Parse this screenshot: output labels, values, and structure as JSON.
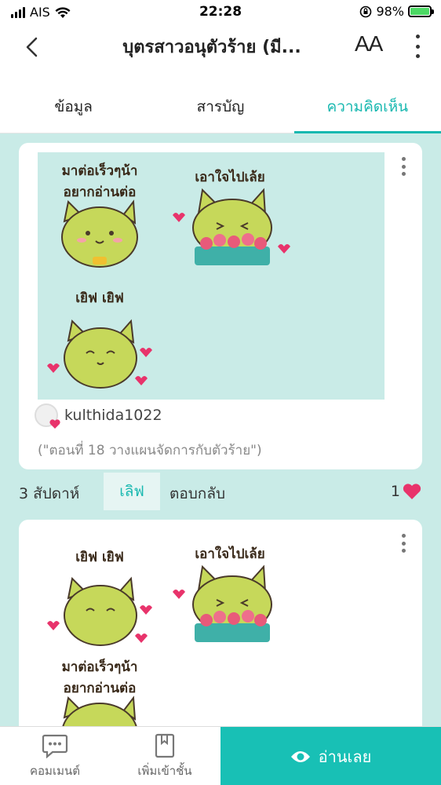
{
  "status_bar": {
    "carrier": "AIS",
    "time": "22:28",
    "battery": "98%"
  },
  "nav": {
    "title": "บุตรสาวอนุตัวร้าย (มี...",
    "font_button_label": "AA"
  },
  "tabs": [
    {
      "label": "ข้อมูล",
      "active": false
    },
    {
      "label": "สารบัญ",
      "active": false
    },
    {
      "label": "ความคิดเห็น",
      "active": true
    }
  ],
  "comments": [
    {
      "stickers": [
        {
          "caption": "มาต่อเร็วๆน้า\nอยากอ่านต่อ"
        },
        {
          "caption": "เอาใจไปเล้ย"
        },
        {
          "caption": "เยิฟ เยิฟ"
        }
      ],
      "author": "kulthida1022",
      "episode": "(\"ตอนที่ 18 วางแผนจัดการกับตัวร้าย\")",
      "time_ago": "3 สัปดาห์",
      "like_label": "เลิฟ",
      "reply_label": "ตอบกลับ",
      "like_count": "1"
    },
    {
      "stickers": [
        {
          "caption": "เยิฟ เยิฟ"
        },
        {
          "caption": "เอาใจไปเล้ย"
        },
        {
          "caption": "มาต่อเร็วๆน้า\nอยากอ่านต่อ"
        }
      ]
    }
  ],
  "bottom_bar": {
    "comment_label": "คอมเมนต์",
    "add_shelf_label": "เพิ่มเข้าชั้น",
    "read_label": "อ่านเลย"
  },
  "colors": {
    "accent": "#18b8b0",
    "background": "#c9ebe7",
    "heart": "#e8336b",
    "cat": "#c6d85a"
  }
}
